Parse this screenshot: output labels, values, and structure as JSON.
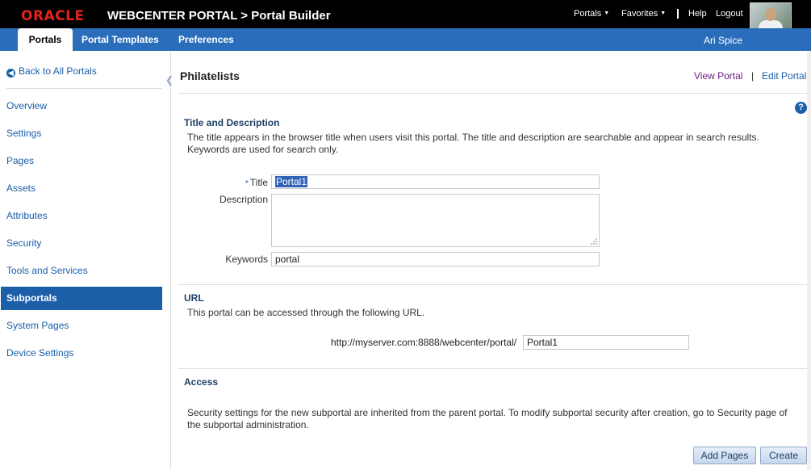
{
  "header": {
    "logo": "ORACLE",
    "app_title": "WEBCENTER PORTAL > Portal Builder",
    "menu_portals": "Portals",
    "menu_favorites": "Favorites",
    "help": "Help",
    "logout": "Logout"
  },
  "tabs": {
    "portals": "Portals",
    "portal_templates": "Portal Templates",
    "preferences": "Preferences",
    "user_name": "Ari Spice"
  },
  "sidebar": {
    "back": "Back to All Portals",
    "items": [
      "Overview",
      "Settings",
      "Pages",
      "Assets",
      "Attributes",
      "Security",
      "Tools and Services",
      "Subportals",
      "System Pages",
      "Device Settings"
    ],
    "active_index": 7
  },
  "main": {
    "title": "Philatelists",
    "view_portal": "View Portal",
    "separator": "|",
    "edit_portal": "Edit Portal",
    "help_glyph": "?"
  },
  "title_section": {
    "heading": "Title and Description",
    "desc1": "The title appears in the browser title when users visit this portal. The title and description are searchable and appear in search results.",
    "desc2": "Keywords are used for search only.",
    "required_mark": "*",
    "title_label": "Title",
    "title_value": "Portal1",
    "description_label": "Description",
    "description_value": "",
    "keywords_label": "Keywords",
    "keywords_value": "portal"
  },
  "url_section": {
    "heading": "URL",
    "desc": "This portal can be accessed through the following URL.",
    "prefix": "http://myserver.com:8888/webcenter/portal/",
    "value": "Portal1"
  },
  "access_section": {
    "heading": "Access",
    "desc1": "Security settings for the new subportal are inherited from the parent portal. To modify subportal security after creation, go to Security page of",
    "desc2": "the subportal administration."
  },
  "buttons": {
    "add_pages": "Add Pages",
    "create": "Create"
  }
}
